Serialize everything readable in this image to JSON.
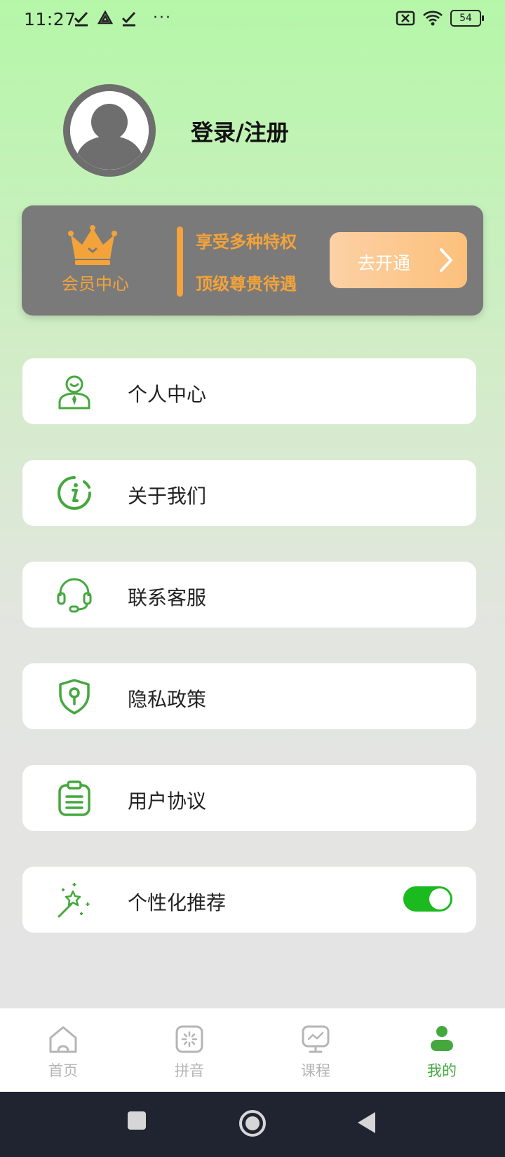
{
  "status_bar": {
    "time": "11:27",
    "battery": "54"
  },
  "profile": {
    "login_label": "登录/注册"
  },
  "vip": {
    "title": "会员中心",
    "line1": "享受多种特权",
    "line2": "顶级尊贵待遇",
    "button_label": "去开通"
  },
  "menu": [
    {
      "label": "个人中心",
      "icon": "person-icon"
    },
    {
      "label": "关于我们",
      "icon": "info-icon"
    },
    {
      "label": "联系客服",
      "icon": "headset-icon"
    },
    {
      "label": "隐私政策",
      "icon": "shield-icon"
    },
    {
      "label": "用户协议",
      "icon": "clipboard-icon"
    },
    {
      "label": "个性化推荐",
      "icon": "magic-wand-icon",
      "toggle_on": true
    }
  ],
  "bottom_nav": [
    {
      "label": "首页",
      "icon": "home-icon"
    },
    {
      "label": "拼音",
      "icon": "pinyin-icon"
    },
    {
      "label": "课程",
      "icon": "course-icon"
    },
    {
      "label": "我的",
      "icon": "profile-icon",
      "active": true
    }
  ],
  "colors": {
    "accent": "#44a83e",
    "vip_orange": "#f3a33a",
    "toggle": "#1bba1f"
  }
}
